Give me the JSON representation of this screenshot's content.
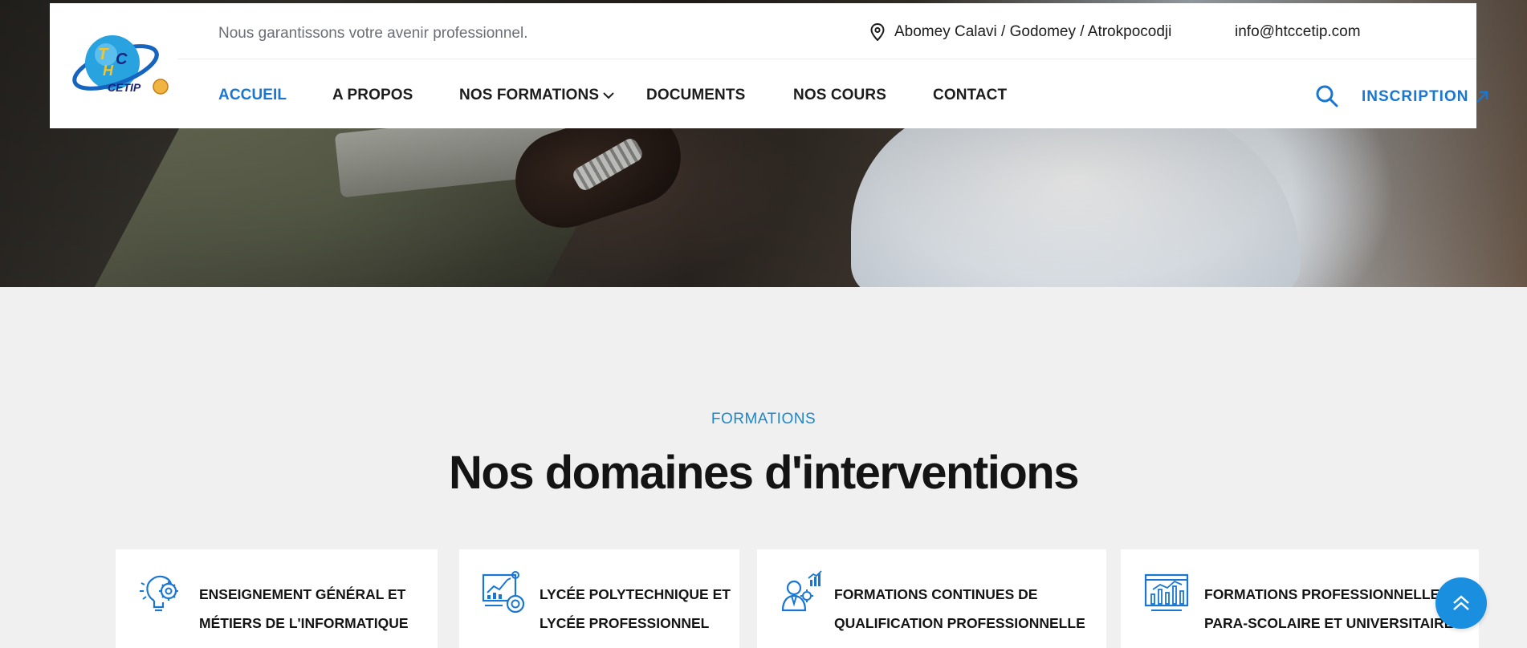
{
  "header": {
    "tagline": "Nous garantissons votre avenir professionnel.",
    "address": "Abomey Calavi / Godomey / Atrokpocodji",
    "email": "info@htccetip.com",
    "logo_text": "HTC CETIP"
  },
  "nav": {
    "items": [
      {
        "label": "ACCUEIL",
        "active": true
      },
      {
        "label": "A PROPOS"
      },
      {
        "label": "NOS FORMATIONS",
        "dropdown": true
      },
      {
        "label": "DOCUMENTS"
      },
      {
        "label": "NOS COURS"
      },
      {
        "label": "CONTACT"
      }
    ],
    "cta_label": "INSCRIPTION"
  },
  "section": {
    "eyebrow": "FORMATIONS",
    "title": "Nos domaines d'interventions"
  },
  "cards": [
    {
      "icon": "lightbulb-gear-icon",
      "line1": "ENSEIGNEMENT GÉNÉRAL ET",
      "line2": "MÉTIERS DE L'INFORMATIQUE"
    },
    {
      "icon": "analytics-report-icon",
      "line1": "LYCÉE POLYTECHNIQUE ET",
      "line2": "LYCÉE PROFESSIONNEL"
    },
    {
      "icon": "professional-growth-icon",
      "line1": "FORMATIONS CONTINUES DE",
      "line2": "QUALIFICATION PROFESSIONNELLE"
    },
    {
      "icon": "chart-board-icon",
      "line1": "FORMATIONS PROFESSIONNELLE",
      "line2": "PARA-SCOLAIRE ET UNIVERSITAIRE"
    }
  ],
  "colors": {
    "accent": "#1976d2",
    "eyebrow": "#1c87c9",
    "scroll_button": "#1a8fe0",
    "page_bg": "#f0f0f0"
  }
}
